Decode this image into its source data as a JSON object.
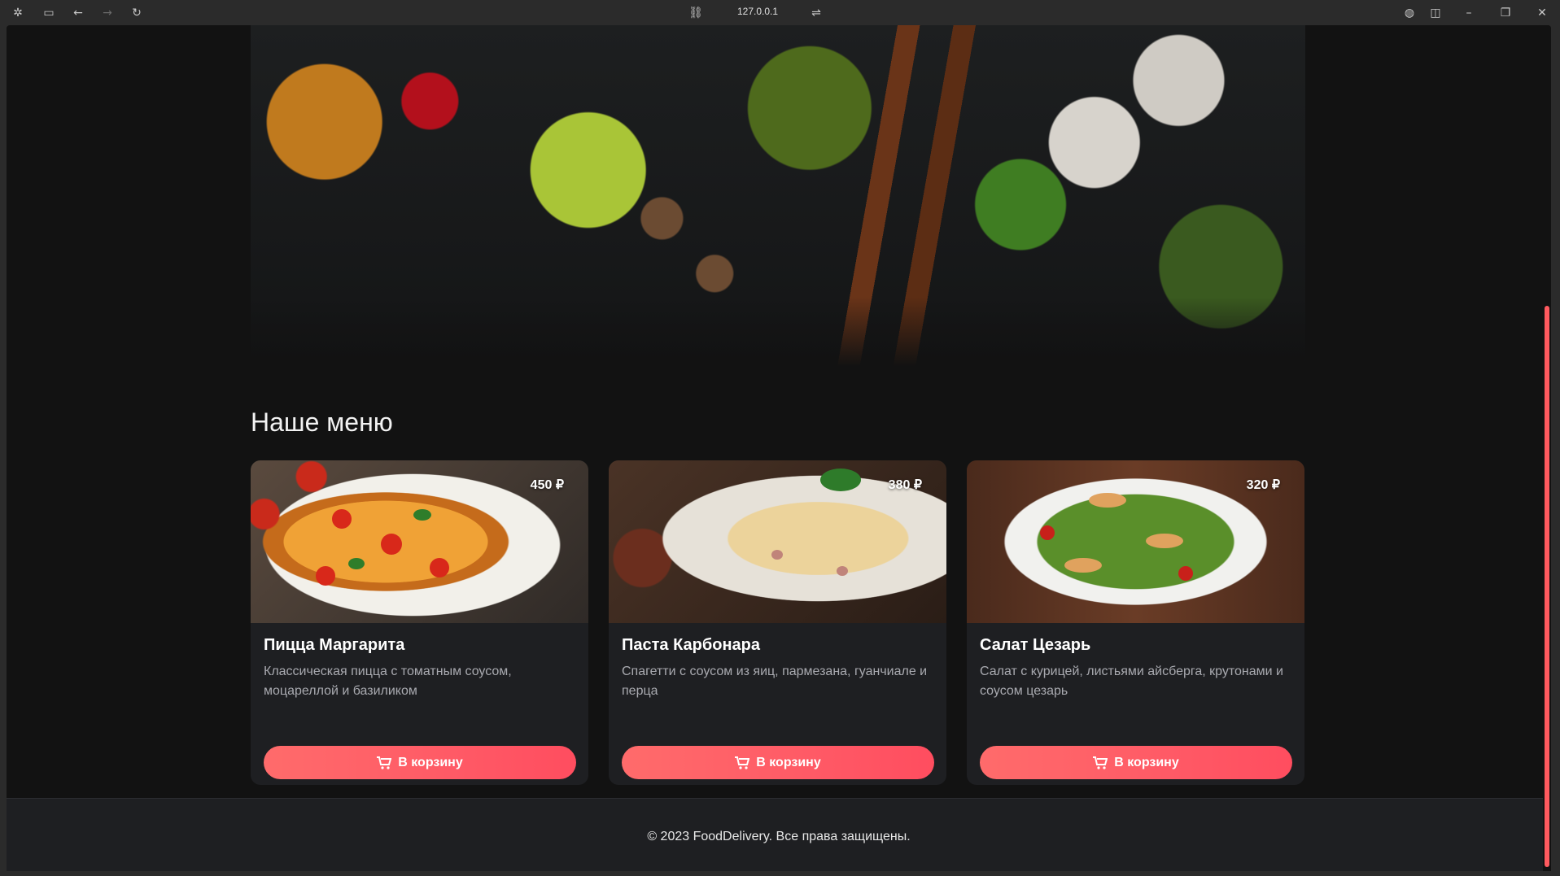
{
  "browser": {
    "url": "127.0.0.1",
    "icons": [
      "app-icon",
      "sidebar-icon",
      "back-icon",
      "forward-icon",
      "reload-icon",
      "link-icon",
      "tune-icon",
      "globe-icon",
      "split-view-icon",
      "minimize-icon",
      "restore-icon",
      "close-icon"
    ]
  },
  "main": {
    "section_title": "Наше меню",
    "add_to_cart_label": "В корзину",
    "items": [
      {
        "name": "Пицца Маргарита",
        "description": "Классическая пицца с томатным соусом, моцареллой и базиликом",
        "price": "450 ₽",
        "image": "pizza-photo"
      },
      {
        "name": "Паста Карбонара",
        "description": "Спагетти с соусом из яиц, пармезана, гуанчиале и перца",
        "price": "380 ₽",
        "image": "pasta-photo"
      },
      {
        "name": "Салат Цезарь",
        "description": "Салат с курицей, листьями айсберга, крутонами и соусом цезарь",
        "price": "320 ₽",
        "image": "salad-photo"
      }
    ]
  },
  "footer": {
    "text": "© 2023 FoodDelivery. Все права защищены."
  },
  "colors": {
    "accent": "#ff5a5f",
    "background": "#121212",
    "card": "#1e1f22"
  }
}
